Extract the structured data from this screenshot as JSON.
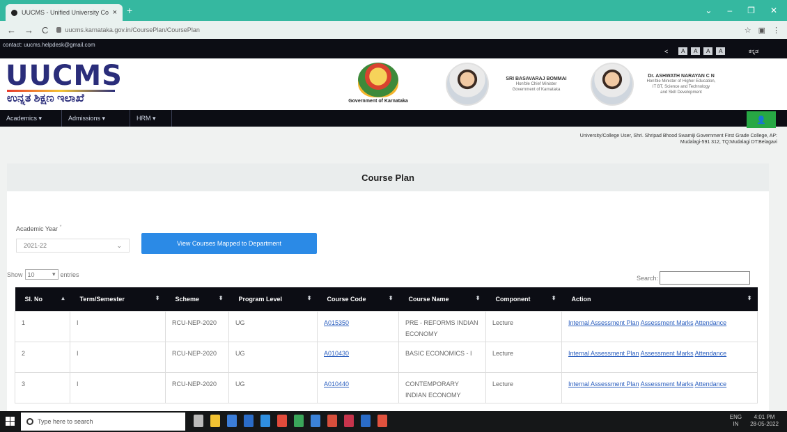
{
  "browser": {
    "tab_title": "UUCMS - Unified University Coll",
    "tab_close": "×",
    "new_tab": "+",
    "url": "uucms.karnataka.gov.in/CoursePlan/CoursePlan",
    "controls": [
      "⌄",
      "–",
      "❐",
      "✕"
    ],
    "nav": [
      "←",
      "→",
      "C"
    ],
    "toolbar_icons": [
      "☆",
      "▣",
      "⋮"
    ]
  },
  "topbar": {
    "contact": "contact: uucms.helpdesk@gmail.com",
    "a11y_symbol": "<",
    "font_buttons": [
      "A",
      "A",
      "A",
      "A"
    ],
    "language": "ಕನ್ನಡ"
  },
  "header": {
    "logo_text_main": "UUCMS",
    "logo_text_kannada": "ಉನ್ನತ ಶಿಕ್ಷಣ ಇಲಾಖೆ",
    "emblem_caption": "Government of Karnataka",
    "leader1_name": "SRI BASAVARAJ BOMMAI",
    "leader1_line1": "Hon'ble Chief Minister",
    "leader1_line2": "Government of Karnataka",
    "leader2_name": "Dr. ASHWATH NARAYAN C N",
    "leader2_line1": "Hon'ble Minister of Higher Education,",
    "leader2_line2": "IT BT, Science and Technology",
    "leader2_line3": "and Skill Development"
  },
  "mainnav": {
    "items": [
      "Academics ▾",
      "Admissions ▾",
      "HRM ▾"
    ],
    "user_icon": "👤"
  },
  "college_line1": "University/College User, Shri. Shripad Bhood Swamiji Government First Grade College, AP:",
  "college_line2": "Mudalagi-591 312, TQ:Mudalagi DT:Belagavi",
  "page": {
    "title": "Course Plan",
    "academic_year_label": "Academic Year",
    "academic_year_required": "*",
    "academic_year_value": "2021-22",
    "view_button": "View Courses Mapped to Department",
    "show_label": "Show",
    "show_value": "10",
    "entries_label": "entries",
    "search_label": "Search:"
  },
  "table": {
    "headers": [
      "Sl. No",
      "Term/Semester",
      "Scheme",
      "Program Level",
      "Course Code",
      "Course Name",
      "Component",
      "Action"
    ],
    "rows": [
      {
        "sl": "1",
        "term": "I",
        "scheme": "RCU-NEP-2020",
        "level": "UG",
        "code": "A015350",
        "name": "PRE - REFORMS INDIAN ECONOMY",
        "component": "Lecture",
        "a1": "Internal Assessment Plan",
        "a2": "Assessment Marks",
        "a3": "Attendance"
      },
      {
        "sl": "2",
        "term": "I",
        "scheme": "RCU-NEP-2020",
        "level": "UG",
        "code": "A010430",
        "name": "BASIC ECONOMICS - I",
        "component": "Lecture",
        "a1": "Internal Assessment Plan",
        "a2": "Assessment Marks",
        "a3": "Attendance"
      },
      {
        "sl": "3",
        "term": "I",
        "scheme": "RCU-NEP-2020",
        "level": "UG",
        "code": "A010440",
        "name": "CONTEMPORARY INDIAN ECONOMY",
        "component": "Lecture",
        "a1": "Internal Assessment Plan",
        "a2": "Assessment Marks",
        "a3": "Attendance"
      }
    ]
  },
  "taskbar": {
    "search_placeholder": "Type here to search",
    "tray_lang": "ENG",
    "tray_region": "IN",
    "tray_time": "4:01 PM",
    "tray_date": "28-05-2022"
  }
}
